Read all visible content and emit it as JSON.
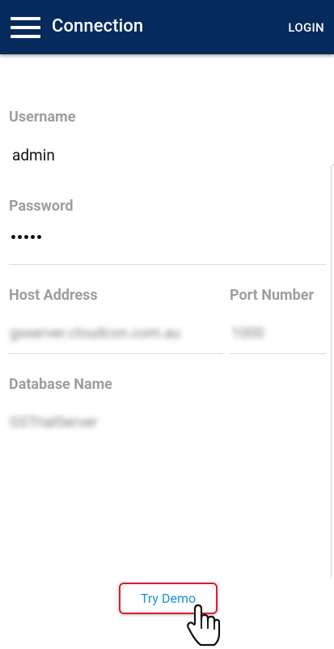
{
  "appbar": {
    "title": "Connection",
    "action_label": "LOGIN",
    "background_color": "#062a5c",
    "menu_icon": "hamburger-menu-icon"
  },
  "form": {
    "username": {
      "label": "Username",
      "value": "admin"
    },
    "password": {
      "label": "Password",
      "masked_value": "•••••"
    },
    "host_address": {
      "label": "Host Address",
      "value": "gsserver.cloudcon.com.au"
    },
    "port_number": {
      "label": "Port Number",
      "value": "1000"
    },
    "database_name": {
      "label": "Database Name",
      "value": "GSTrialServer"
    }
  },
  "try_demo": {
    "label": "Try Demo",
    "highlight_color": "#e21a2c",
    "text_color": "#1e8fd6"
  },
  "pointer": {
    "icon": "hand-pointer-icon"
  }
}
